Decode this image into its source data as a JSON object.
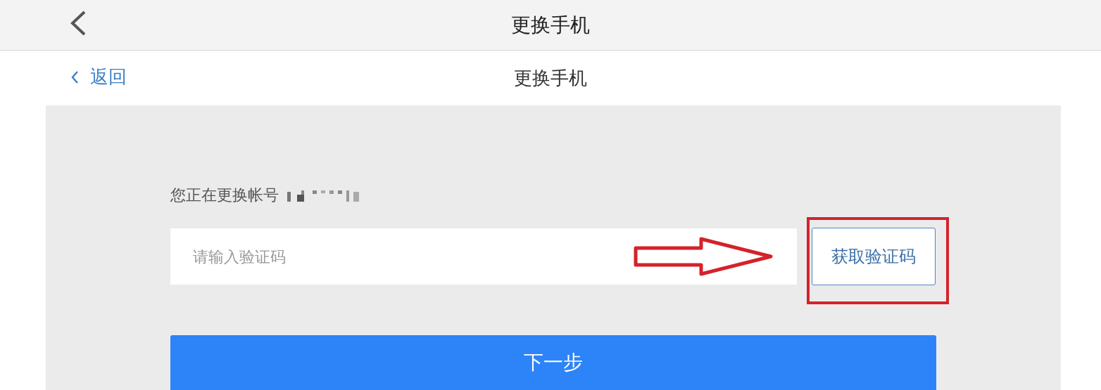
{
  "nav_bar": {
    "title": "更换手机"
  },
  "header": {
    "back_link": "返回",
    "title": "更换手机"
  },
  "form": {
    "account_label": "您正在更换帐号",
    "code_field": {
      "placeholder": "请输入验证码"
    },
    "get_code_button": "获取验证码",
    "next_button": "下一步"
  }
}
